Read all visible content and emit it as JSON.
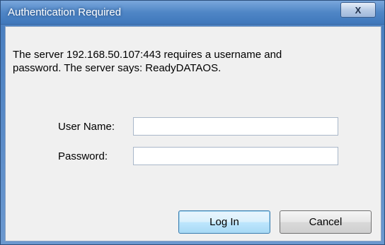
{
  "window": {
    "title": "Authentication Required",
    "close_glyph": "X"
  },
  "message": {
    "line1": "The server 192.168.50.107:443 requires a username and",
    "line2": "password. The server says: ReadyDATAOS."
  },
  "form": {
    "username_label": "User Name:",
    "username_value": "",
    "password_label": "Password:",
    "password_value": ""
  },
  "buttons": {
    "login_label": "Log In",
    "cancel_label": "Cancel"
  },
  "colors": {
    "titlebar": "#4f86c6",
    "client_background": "#f0f0f0",
    "default_button_border": "#3c7fb1"
  },
  "icons": {
    "close": "close-icon"
  }
}
